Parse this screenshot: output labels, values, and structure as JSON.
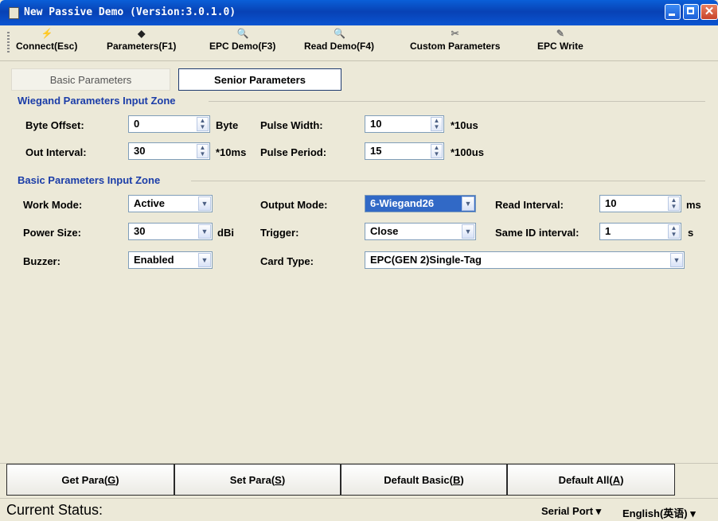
{
  "window": {
    "title": "New Passive Demo (Version:3.0.1.0)"
  },
  "toolbar": {
    "items": [
      {
        "label": "Connect(Esc)",
        "icon": "connect-icon"
      },
      {
        "label": "Parameters(F1)",
        "icon": "parameters-icon"
      },
      {
        "label": "EPC Demo(F3)",
        "icon": "search-icon"
      },
      {
        "label": "Read Demo(F4)",
        "icon": "search-icon"
      },
      {
        "label": "Custom Parameters",
        "icon": "tools-icon"
      },
      {
        "label": "EPC Write",
        "icon": "write-icon"
      }
    ]
  },
  "tabs": {
    "basic": "Basic Parameters",
    "senior": "Senior Parameters"
  },
  "wiegand": {
    "title": "Wiegand Parameters Input Zone",
    "byte_offset_label": "Byte Offset:",
    "byte_offset_value": "0",
    "byte_offset_unit": "Byte",
    "pulse_width_label": "Pulse Width:",
    "pulse_width_value": "10",
    "pulse_width_unit": "*10us",
    "out_interval_label": "Out Interval:",
    "out_interval_value": "30",
    "out_interval_unit": "*10ms",
    "pulse_period_label": "Pulse Period:",
    "pulse_period_value": "15",
    "pulse_period_unit": "*100us"
  },
  "basic": {
    "title": "Basic Parameters Input Zone",
    "work_mode_label": "Work Mode:",
    "work_mode_value": "Active",
    "output_mode_label": "Output Mode:",
    "output_mode_value": "6-Wiegand26",
    "read_interval_label": "Read Interval:",
    "read_interval_value": "10",
    "read_interval_unit": "ms",
    "power_size_label": "Power Size:",
    "power_size_value": "30",
    "power_size_unit": "dBi",
    "trigger_label": "Trigger:",
    "trigger_value": "Close",
    "same_id_label": "Same ID interval:",
    "same_id_value": "1",
    "same_id_unit": "s",
    "buzzer_label": "Buzzer:",
    "buzzer_value": "Enabled",
    "card_type_label": "Card Type:",
    "card_type_value": "EPC(GEN 2)Single-Tag"
  },
  "buttons": {
    "get_para": "Get Para(",
    "get_para_key": "G",
    "set_para": "Set Para(",
    "set_para_key": "S",
    "default_basic": "Default Basic(",
    "default_basic_key": "B",
    "default_all": "Default All(",
    "default_all_key": "A",
    "close_paren": ")"
  },
  "status": {
    "label": "Current Status:",
    "serial_port": "Serial Port ▾",
    "language": "English(英语) ▾"
  }
}
